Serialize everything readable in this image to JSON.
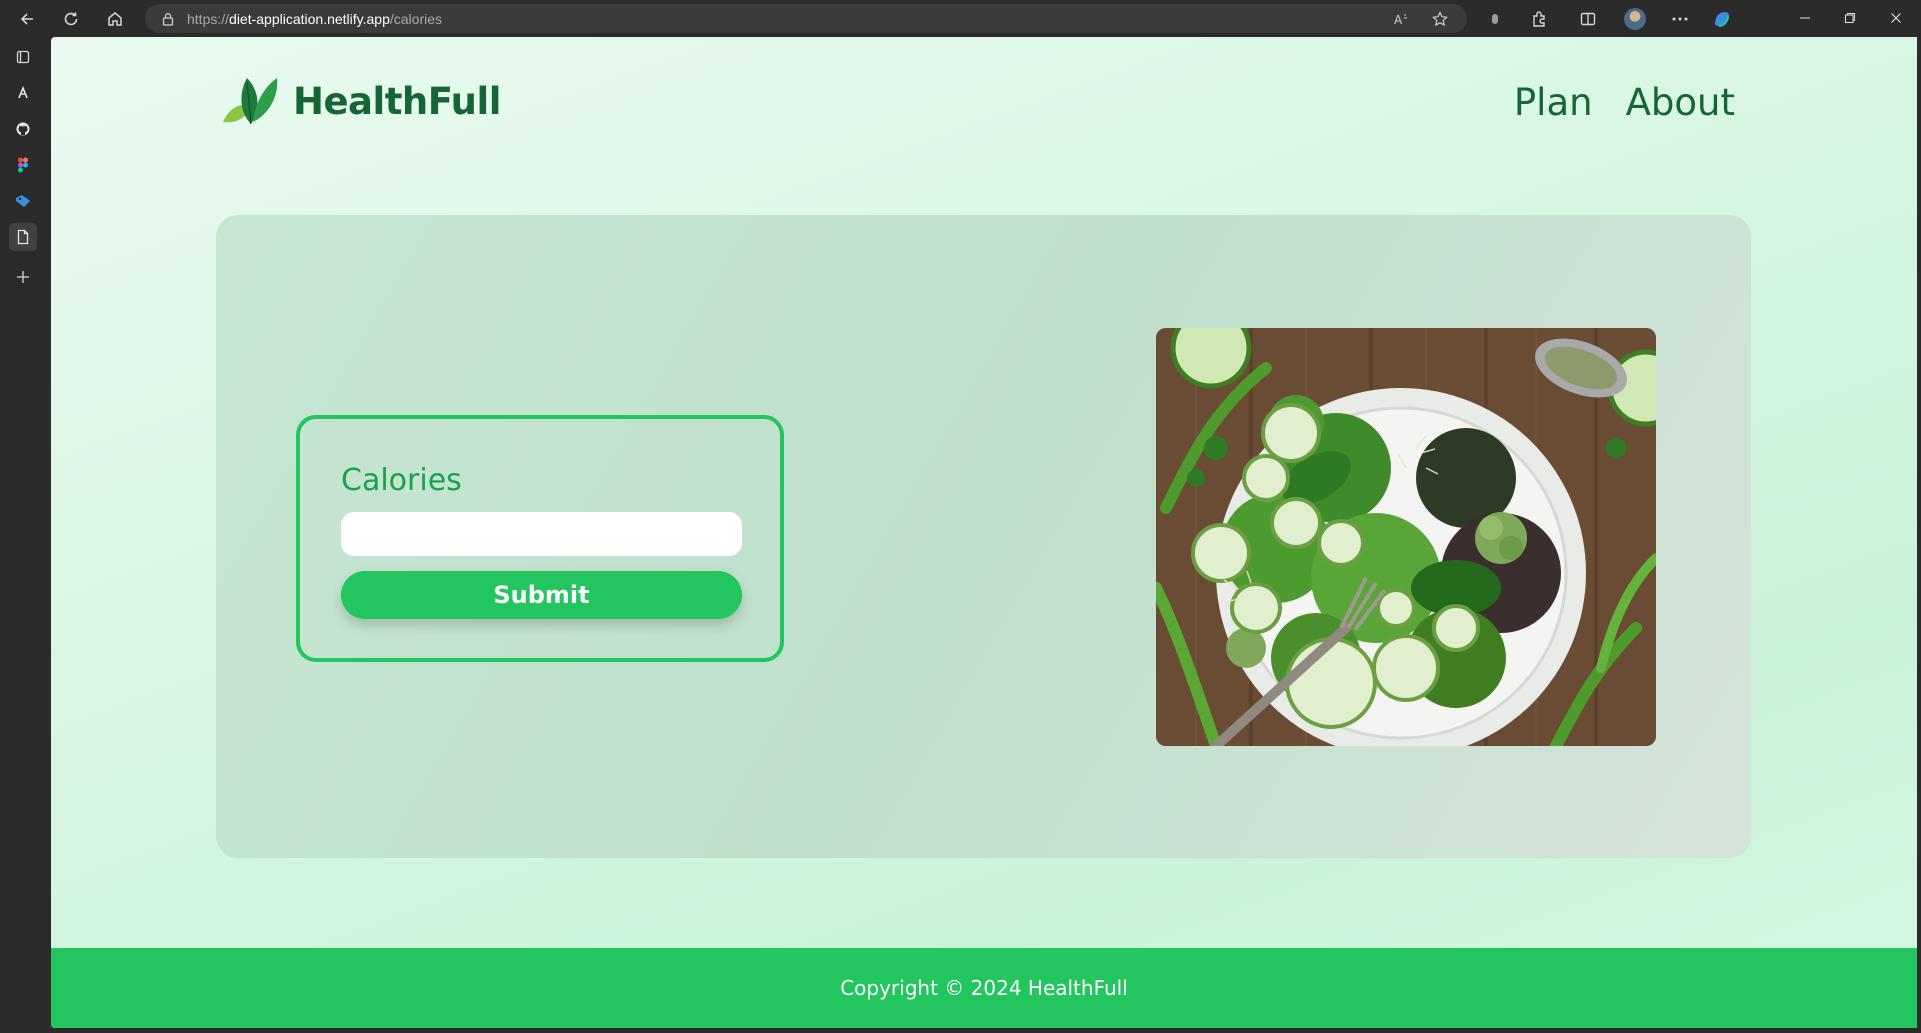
{
  "browser": {
    "url_proto": "https://",
    "url_host": "diet-application.netlify.app",
    "url_path": "/calories"
  },
  "site": {
    "brand_name": "HealthFull",
    "nav": [
      "Plan",
      "About"
    ]
  },
  "form": {
    "label": "Calories",
    "input_value": "",
    "submit_label": "Submit"
  },
  "footer": {
    "copyright": "Copyright © 2024 HealthFull"
  },
  "colors": {
    "accent": "#22c55e",
    "brand_text": "#166534",
    "label_text": "#16a34a"
  },
  "icons": {
    "logo": "leaf-icon",
    "image": "salad-photo"
  }
}
